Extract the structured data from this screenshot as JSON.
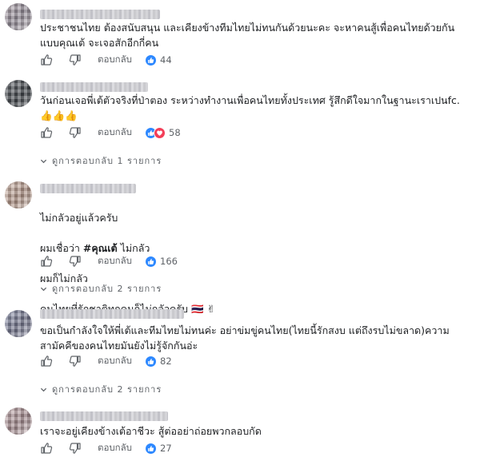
{
  "labels": {
    "reply": "ตอบกลับ"
  },
  "colors": {
    "like": "#2d88ff",
    "love": "#f33e58",
    "meta": "#5f6368"
  },
  "comments": [
    {
      "text": "ประชาชนไทย ต้องสนับสนุน และเคียงข้างทีมไทยไม่ทนกันด้วยนะคะ จะหาคนสู้เพื่อคนไทยด้วยกัน\nแบบคุณเต้ จะเจอสักอีกกี่คน",
      "reactions": [
        "like"
      ],
      "reaction_count": "44"
    },
    {
      "text": "วันก่อนเจอพี่เต้ตัวจริงที่ป่าตอง ระหว่างทำงานเพื่อคนไทยทั้งประเทศ รู้สึกดีใจมากในฐานะเราเปนfc.\n👍👍👍",
      "reactions": [
        "like",
        "love"
      ],
      "reaction_count": "58",
      "replies_label": "ดูการตอบกลับ 1 รายการ"
    },
    {
      "line1": "ไม่กลัวอยู่แล้วครับ",
      "line2_prefix": "ผมเชื่อว่า ",
      "line2_bold": "#คุณเต้",
      "line2_suffix": " ไม่กลัว",
      "line3": "ผมก็ไม่กลัว",
      "line4": "คนไทยที่รักชาติทุกคนก็ไม่กลัวครับ 🇹🇭 ✌",
      "reactions": [
        "like"
      ],
      "reaction_count": "166",
      "replies_label": "ดูการตอบกลับ 2 รายการ"
    },
    {
      "text": "ขอเป็นกำลังใจให้พี่เต้และทีมไทยไม่ทนค่ะ อย่าข่มขู่คนไทย(ไทยนี้รักสงบ แต่ถึงรบไม่ขลาด)ความ\nสามัคคีของคนไทยมันยังไม่รู้จักกันอ่ะ",
      "reactions": [
        "like"
      ],
      "reaction_count": "82",
      "replies_label": "ดูการตอบกลับ 2 รายการ"
    },
    {
      "text": "เราจะอยู่เคียงข้างเต้อาชีวะ สู้ต่ออย่าถ่อยพวกลอบกัด",
      "reactions": [
        "like"
      ],
      "reaction_count": "27"
    }
  ]
}
